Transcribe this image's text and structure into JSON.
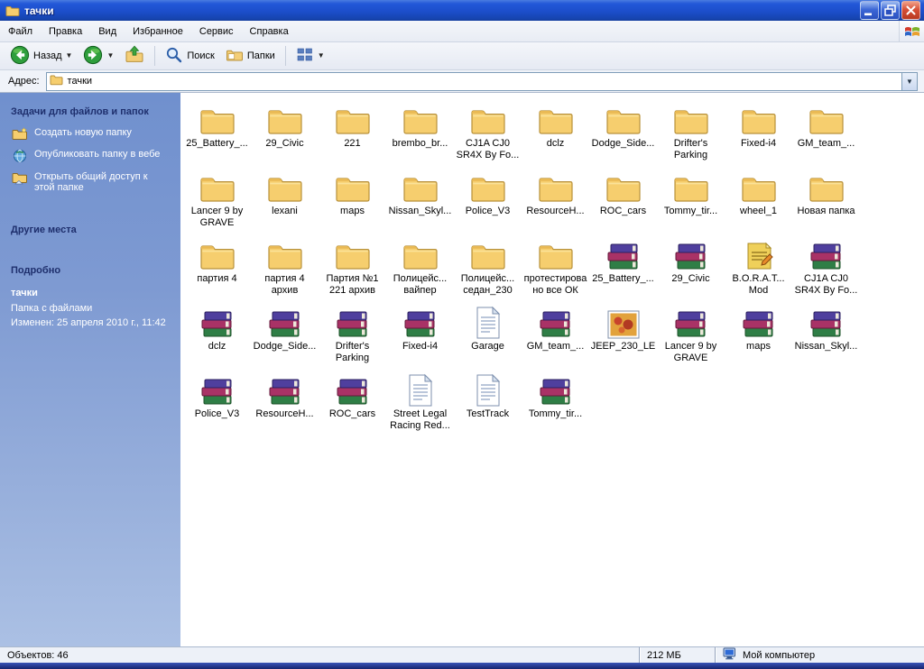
{
  "window": {
    "title": "тачки"
  },
  "menu_bar": {
    "items": [
      "Файл",
      "Правка",
      "Вид",
      "Избранное",
      "Сервис",
      "Справка"
    ]
  },
  "toolbar": {
    "back_label": "Назад",
    "search_label": "Поиск",
    "folders_label": "Папки"
  },
  "address_bar": {
    "label": "Адрес:",
    "value": "тачки"
  },
  "sidebar": {
    "file_tasks": {
      "header": "Задачи для файлов и папок",
      "items": [
        "Создать новую папку",
        "Опубликовать папку в вебе",
        "Открыть общий доступ к этой папке"
      ]
    },
    "other_places": {
      "header": "Другие места"
    },
    "details": {
      "header": "Подробно",
      "name": "тачки",
      "type": "Папка с файлами",
      "modified": "Изменен: 25 апреля 2010 г., 11:42"
    }
  },
  "items": [
    {
      "label": "25_Battery_...",
      "type": "folder"
    },
    {
      "label": "29_Civic",
      "type": "folder"
    },
    {
      "label": "221",
      "type": "folder"
    },
    {
      "label": "brembo_br...",
      "type": "folder"
    },
    {
      "label": "CJ1A CJ0 SR4X By Fo...",
      "type": "folder"
    },
    {
      "label": "dclz",
      "type": "folder"
    },
    {
      "label": "Dodge_Side...",
      "type": "folder"
    },
    {
      "label": "Drifter's Parking",
      "type": "folder"
    },
    {
      "label": "Fixed-i4",
      "type": "folder"
    },
    {
      "label": "GM_team_...",
      "type": "folder"
    },
    {
      "label": "Lancer 9 by GRAVE",
      "type": "folder"
    },
    {
      "label": "lexani",
      "type": "folder"
    },
    {
      "label": "maps",
      "type": "folder"
    },
    {
      "label": "Nissan_Skyl...",
      "type": "folder"
    },
    {
      "label": "Police_V3",
      "type": "folder"
    },
    {
      "label": "ResourceH...",
      "type": "folder"
    },
    {
      "label": "ROC_cars",
      "type": "folder"
    },
    {
      "label": "Tommy_tir...",
      "type": "folder"
    },
    {
      "label": "wheel_1",
      "type": "folder"
    },
    {
      "label": "Новая папка",
      "type": "folder"
    },
    {
      "label": "партия 4",
      "type": "folder"
    },
    {
      "label": "партия 4 архив",
      "type": "folder"
    },
    {
      "label": "Партия №1 221 архив",
      "type": "folder"
    },
    {
      "label": "Полицейс... вайпер",
      "type": "folder"
    },
    {
      "label": "Полицейс... седан_230",
      "type": "folder"
    },
    {
      "label": "протестировано все ОК",
      "type": "folder"
    },
    {
      "label": "25_Battery_...",
      "type": "rar"
    },
    {
      "label": "29_Civic",
      "type": "rar"
    },
    {
      "label": "B.O.R.A.T... Mod",
      "type": "mod"
    },
    {
      "label": "CJ1A CJ0 SR4X By Fo...",
      "type": "rar"
    },
    {
      "label": "dclz",
      "type": "rar"
    },
    {
      "label": "Dodge_Side...",
      "type": "rar"
    },
    {
      "label": "Drifter's Parking",
      "type": "rar"
    },
    {
      "label": "Fixed-i4",
      "type": "rar"
    },
    {
      "label": "Garage",
      "type": "doc"
    },
    {
      "label": "GM_team_...",
      "type": "rar"
    },
    {
      "label": "JEEP_230_LE",
      "type": "image"
    },
    {
      "label": "Lancer 9 by GRAVE",
      "type": "rar"
    },
    {
      "label": "maps",
      "type": "rar"
    },
    {
      "label": "Nissan_Skyl...",
      "type": "rar"
    },
    {
      "label": "Police_V3",
      "type": "rar"
    },
    {
      "label": "ResourceH...",
      "type": "rar"
    },
    {
      "label": "ROC_cars",
      "type": "rar"
    },
    {
      "label": "Street Legal Racing Red...",
      "type": "doc"
    },
    {
      "label": "TestTrack",
      "type": "doc"
    },
    {
      "label": "Tommy_tir...",
      "type": "rar"
    }
  ],
  "status_bar": {
    "objects": "Объектов: 46",
    "size": "212 МБ",
    "location": "Мой компьютер"
  },
  "colors": {
    "titlebar_blue": "#1C4ECB",
    "sidebar_top": "#7090CE",
    "sidebar_bottom": "#ABC0E4",
    "folder_yellow": "#F6CE6E",
    "taskbar_navy": "#16246E"
  }
}
